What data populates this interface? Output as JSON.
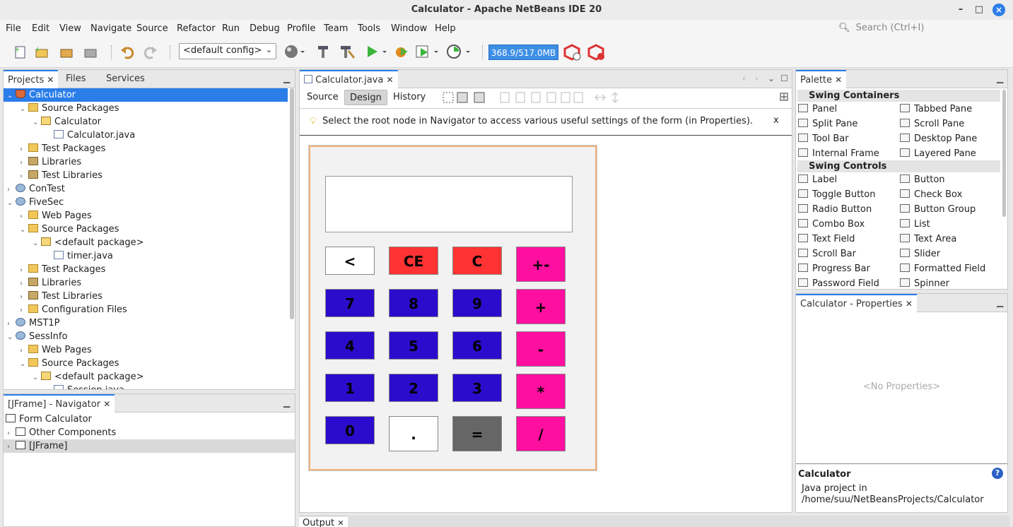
{
  "window": {
    "title": "Calculator - Apache NetBeans IDE 20",
    "min": "–",
    "max": "□",
    "close": "×"
  },
  "menu": [
    "File",
    "Edit",
    "View",
    "Navigate",
    "Source",
    "Refactor",
    "Run",
    "Debug",
    "Profile",
    "Team",
    "Tools",
    "Window",
    "Help"
  ],
  "search": {
    "placeholder": "Search (Ctrl+I)"
  },
  "toolbar": {
    "config": "<default config>",
    "memory": "368.9/517.0MB"
  },
  "projects": {
    "tabs": [
      "Projects",
      "Files",
      "Services"
    ],
    "tree": [
      {
        "label": "Calculator",
        "icon": "cup-icon",
        "arrow": "⌄",
        "selected": true
      },
      {
        "label": "Source Packages",
        "icon": "folder-icon",
        "arrow": "⌄"
      },
      {
        "label": "Calculator",
        "icon": "package-icon",
        "arrow": "⌄"
      },
      {
        "label": "Calculator.java",
        "icon": "java-file-icon",
        "arrow": ""
      },
      {
        "label": "Test Packages",
        "icon": "folder-icon",
        "arrow": "›"
      },
      {
        "label": "Libraries",
        "icon": "library-icon",
        "arrow": "›"
      },
      {
        "label": "Test Libraries",
        "icon": "library-icon",
        "arrow": "›"
      },
      {
        "label": "ConTest",
        "icon": "globe-icon",
        "arrow": "›"
      },
      {
        "label": "FiveSec",
        "icon": "globe-icon",
        "arrow": "⌄"
      },
      {
        "label": "Web Pages",
        "icon": "folder-icon",
        "arrow": "›"
      },
      {
        "label": "Source Packages",
        "icon": "folder-icon",
        "arrow": "⌄"
      },
      {
        "label": "<default package>",
        "icon": "package-icon",
        "arrow": "⌄"
      },
      {
        "label": "timer.java",
        "icon": "java-file-icon",
        "arrow": ""
      },
      {
        "label": "Test Packages",
        "icon": "folder-icon",
        "arrow": "›"
      },
      {
        "label": "Libraries",
        "icon": "library-icon",
        "arrow": "›"
      },
      {
        "label": "Test Libraries",
        "icon": "library-icon",
        "arrow": "›"
      },
      {
        "label": "Configuration Files",
        "icon": "folder-icon",
        "arrow": "›"
      },
      {
        "label": "MST1P",
        "icon": "globe-icon",
        "arrow": "›"
      },
      {
        "label": "SessInfo",
        "icon": "globe-icon",
        "arrow": "⌄"
      },
      {
        "label": "Web Pages",
        "icon": "folder-icon",
        "arrow": "›"
      },
      {
        "label": "Source Packages",
        "icon": "folder-icon",
        "arrow": "⌄"
      },
      {
        "label": "<default package>",
        "icon": "package-icon",
        "arrow": "⌄"
      },
      {
        "label": "Session.java",
        "icon": "java-file-icon",
        "arrow": ""
      }
    ]
  },
  "navigator": {
    "tab": "[JFrame] - Navigator",
    "items": [
      {
        "label": "Form Calculator",
        "arrow": ""
      },
      {
        "label": "Other Components",
        "arrow": "›"
      },
      {
        "label": "[JFrame]",
        "arrow": "›"
      }
    ]
  },
  "editor": {
    "tab": "Calculator.java",
    "subtabs": [
      "Source",
      "Design",
      "History"
    ],
    "hint": "Select the root node in Navigator to access various useful settings of the form (in Properties).",
    "hint_close": "x"
  },
  "calculator": {
    "buttons": [
      {
        "label": "<",
        "bg": "#ffffff",
        "fg": "#000000"
      },
      {
        "label": "CE",
        "bg": "#ff3333",
        "fg": "#000000"
      },
      {
        "label": "C",
        "bg": "#ff3333",
        "fg": "#000000"
      },
      {
        "label": "+-",
        "bg": "#ff0fa0",
        "fg": "#000000"
      },
      {
        "label": "7",
        "bg": "#2c0ccc",
        "fg": "#000000"
      },
      {
        "label": "8",
        "bg": "#2c0ccc",
        "fg": "#000000"
      },
      {
        "label": "9",
        "bg": "#2c0ccc",
        "fg": "#000000"
      },
      {
        "label": "+",
        "bg": "#ff0fa0",
        "fg": "#000000"
      },
      {
        "label": "4",
        "bg": "#2c0ccc",
        "fg": "#000000"
      },
      {
        "label": "5",
        "bg": "#2c0ccc",
        "fg": "#000000"
      },
      {
        "label": "6",
        "bg": "#2c0ccc",
        "fg": "#000000"
      },
      {
        "label": "-",
        "bg": "#ff0fa0",
        "fg": "#000000"
      },
      {
        "label": "1",
        "bg": "#2c0ccc",
        "fg": "#000000"
      },
      {
        "label": "2",
        "bg": "#2c0ccc",
        "fg": "#000000"
      },
      {
        "label": "3",
        "bg": "#2c0ccc",
        "fg": "#000000"
      },
      {
        "label": "*",
        "bg": "#ff0fa0",
        "fg": "#000000"
      },
      {
        "label": "0",
        "bg": "#2c0ccc",
        "fg": "#000000"
      },
      {
        "label": ".",
        "bg": "#ffffff",
        "fg": "#000000"
      },
      {
        "label": "=",
        "bg": "#666666",
        "fg": "#000000"
      },
      {
        "label": "/",
        "bg": "#ff0fa0",
        "fg": "#000000"
      }
    ]
  },
  "palette": {
    "tab": "Palette",
    "categories": [
      {
        "name": "Swing Containers",
        "items": [
          "Panel",
          "Tabbed Pane",
          "Split Pane",
          "Scroll Pane",
          "Tool Bar",
          "Desktop Pane",
          "Internal Frame",
          "Layered Pane"
        ]
      },
      {
        "name": "Swing Controls",
        "items": [
          "Label",
          "Button",
          "Toggle Button",
          "Check Box",
          "Radio Button",
          "Button Group",
          "Combo Box",
          "List",
          "Text Field",
          "Text Area",
          "Scroll Bar",
          "Slider",
          "Progress Bar",
          "Formatted Field",
          "Password Field",
          "Spinner"
        ]
      }
    ]
  },
  "properties": {
    "tab": "Calculator - Properties",
    "empty": "<No Properties>",
    "info_title": "Calculator",
    "info_line1": "Java project in",
    "info_line2": "/home/suu/NetBeansProjects/Calculator"
  },
  "output": {
    "tab": "Output"
  }
}
